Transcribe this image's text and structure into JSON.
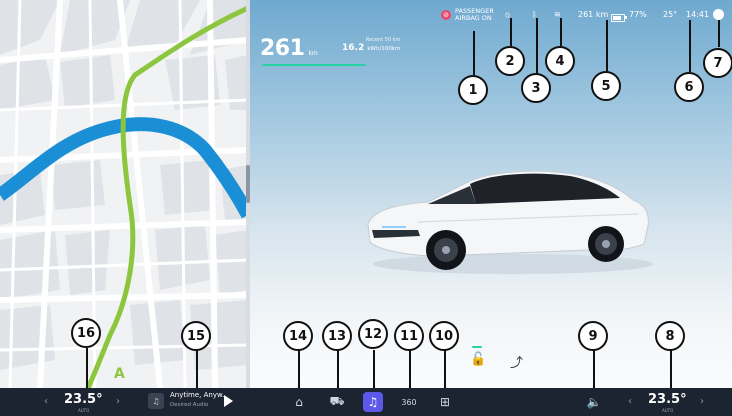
{
  "status": {
    "airbag_line1": "PASSENGER",
    "airbag_line2": "AIRBAG ON",
    "range_text": "261 km",
    "battery_pct": "77%",
    "outside_temp": "25°",
    "time": "14:41"
  },
  "range_panel": {
    "value": "261",
    "unit": "km",
    "sub_label": "Recent 50 km",
    "consumption": "16.2",
    "consumption_unit": "kWh/100km"
  },
  "callouts": [
    "1",
    "2",
    "3",
    "4",
    "5",
    "6",
    "7",
    "8",
    "9",
    "10",
    "11",
    "12",
    "13",
    "14",
    "15",
    "16"
  ],
  "map": {
    "route_marker": "A"
  },
  "dock": {
    "left_temp": "23.5°",
    "left_temp_label": "AUTO",
    "right_temp": "23.5°",
    "right_temp_label": "AUTO",
    "media_title": "Anytime, Anyw..",
    "media_subtitle": "Desired Audio",
    "icon_360": "360",
    "chevron_left": "‹",
    "chevron_right": "›"
  },
  "colors": {
    "accent_green": "#28d3a3",
    "route_green": "#8cc63e",
    "river_blue": "#1a8fd6",
    "active_music": "#5b58ea",
    "dock_bg": "#1c2431"
  }
}
